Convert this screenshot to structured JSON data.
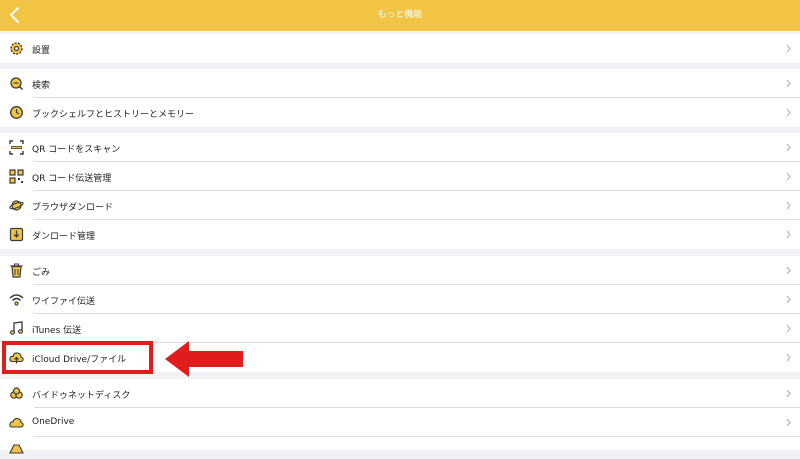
{
  "header": {
    "title": "もっと機能",
    "back_icon": "chevron-left-icon"
  },
  "colors": {
    "accent": "#f2c444",
    "highlight": "#e01c1c",
    "icon": "#3a3a3a"
  },
  "menu": {
    "settings": "設置",
    "search": "検索",
    "bookshelf_history_memory": "ブックシェルフとヒストリーとメモリー",
    "qr_scan": "QR コードをスキャン",
    "qr_transfer": "QR コード伝送管理",
    "browser_download": "ブラウザダンロード",
    "download_manager": "ダンロード管理",
    "trash": "ごみ",
    "wifi_transfer": "ワイファイ伝送",
    "itunes_transfer": "iTunes 伝送",
    "icloud_files": "iCloud Drive/ファイル",
    "baidu_netdisk": "バイドゥネットディスク",
    "onedrive": "OneDrive"
  }
}
